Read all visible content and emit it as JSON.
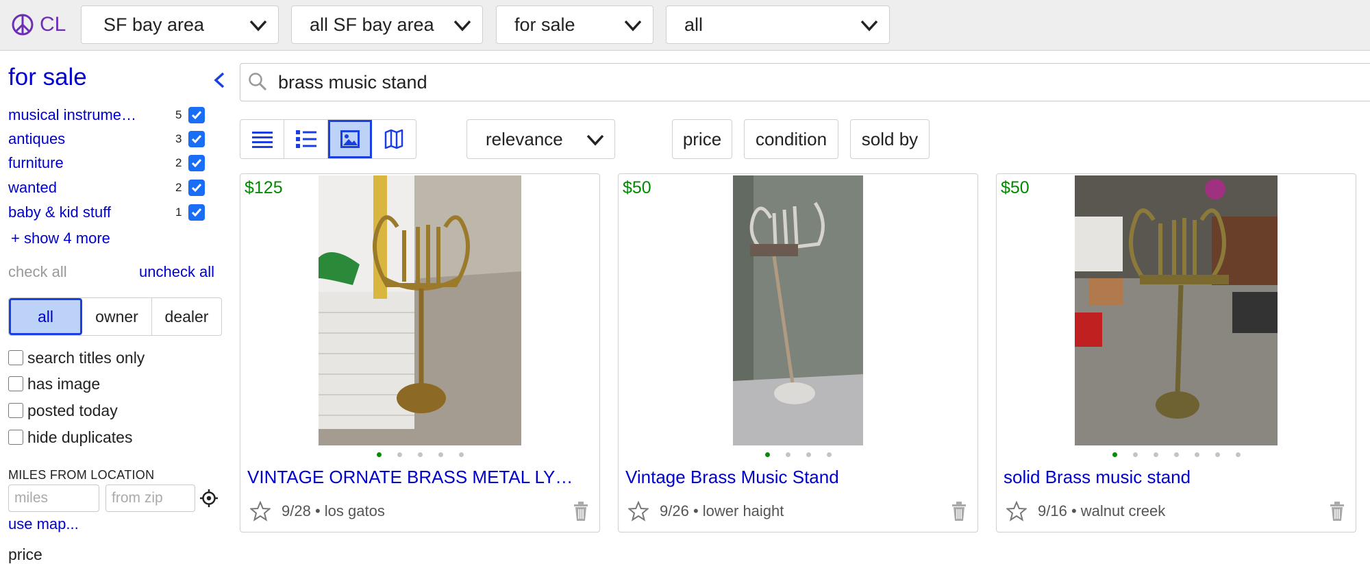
{
  "topbar": {
    "logo": "CL",
    "dropdowns": [
      "SF bay area",
      "all SF bay area",
      "for sale",
      "all"
    ]
  },
  "sidebar": {
    "title": "for sale",
    "categories": [
      {
        "label": "musical instrume…",
        "count": "5"
      },
      {
        "label": "antiques",
        "count": "3"
      },
      {
        "label": "furniture",
        "count": "2"
      },
      {
        "label": "wanted",
        "count": "2"
      },
      {
        "label": "baby & kid stuff",
        "count": "1"
      }
    ],
    "show_more": "+ show 4 more",
    "check_all": "check all",
    "uncheck_all": "uncheck all",
    "seller": [
      "all",
      "owner",
      "dealer"
    ],
    "options": [
      "search titles only",
      "has image",
      "posted today",
      "hide duplicates"
    ],
    "miles_title": "MILES FROM LOCATION",
    "miles_placeholder": "miles",
    "zip_placeholder": "from zip",
    "use_map": "use map...",
    "price_header": "price"
  },
  "search": {
    "value": "brass music stand"
  },
  "toolbar": {
    "sort": "relevance",
    "filters": [
      "price",
      "condition",
      "sold by"
    ]
  },
  "results": [
    {
      "price": "$125",
      "title": "VINTAGE ORNATE BRASS METAL LY…",
      "date": "9/28",
      "location": "los gatos",
      "dots": 5
    },
    {
      "price": "$50",
      "title": "Vintage Brass Music Stand",
      "date": "9/26",
      "location": "lower haight",
      "dots": 4
    },
    {
      "price": "$50",
      "title": "solid Brass music stand",
      "date": "9/16",
      "location": "walnut creek",
      "dots": 7
    }
  ],
  "colors": {
    "link": "#0000cc",
    "price": "#008a00",
    "selected_bg": "#bcd3f7",
    "logo": "#6b2fb6"
  }
}
